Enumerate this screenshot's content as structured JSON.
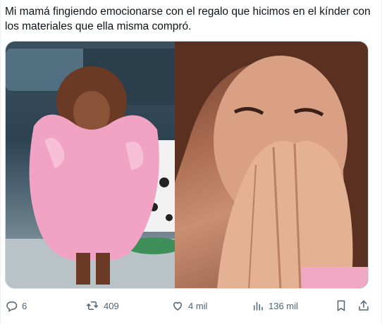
{
  "tweet": {
    "text": "Mi mamá fingiendo emocionarse con el regalo que hicimos en el kínder con los materiales que ella misma compró."
  },
  "actions": {
    "replies": "6",
    "reposts": "409",
    "likes": "4 mil",
    "views": "136 mil"
  },
  "icons": {
    "reply": "reply-icon",
    "repost": "repost-icon",
    "like": "heart-icon",
    "views": "views-icon",
    "bookmark": "bookmark-icon",
    "share": "share-icon"
  },
  "colors": {
    "text": "#0f1419",
    "muted": "#536471",
    "border": "#cfd9de"
  }
}
